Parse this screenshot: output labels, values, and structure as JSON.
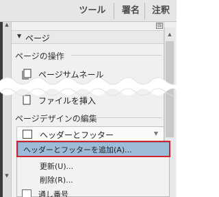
{
  "toolbar": {
    "tools_label": "ツール",
    "sign_label": "署名",
    "comment_label": "注釈"
  },
  "panel": {
    "section_title": "ページ",
    "groups": [
      {
        "label": "ページの操作",
        "items": [
          {
            "label": "ページサムネール",
            "icon": "page-thumbnails-icon"
          },
          {
            "label": "ファイルを挿入",
            "icon": "insert-file-icon"
          }
        ]
      },
      {
        "label": "ページデザインの編集",
        "dropdown": {
          "label": "ヘッダーとフッター",
          "icon": "header-footer-icon"
        }
      }
    ],
    "menu": {
      "items": [
        {
          "label": "ヘッダーとフッターを追加(A)...",
          "highlighted": true
        },
        {
          "label": "更新(U)..."
        },
        {
          "label": "削除(R)..."
        }
      ]
    },
    "partial_item": {
      "label": "通し番号"
    }
  },
  "colors": {
    "highlight": "#9dbcd9",
    "annotation_frame": "#d0242c",
    "toolbar_bg": "#e6e6e6",
    "panel_bg": "#f0f0f0"
  }
}
